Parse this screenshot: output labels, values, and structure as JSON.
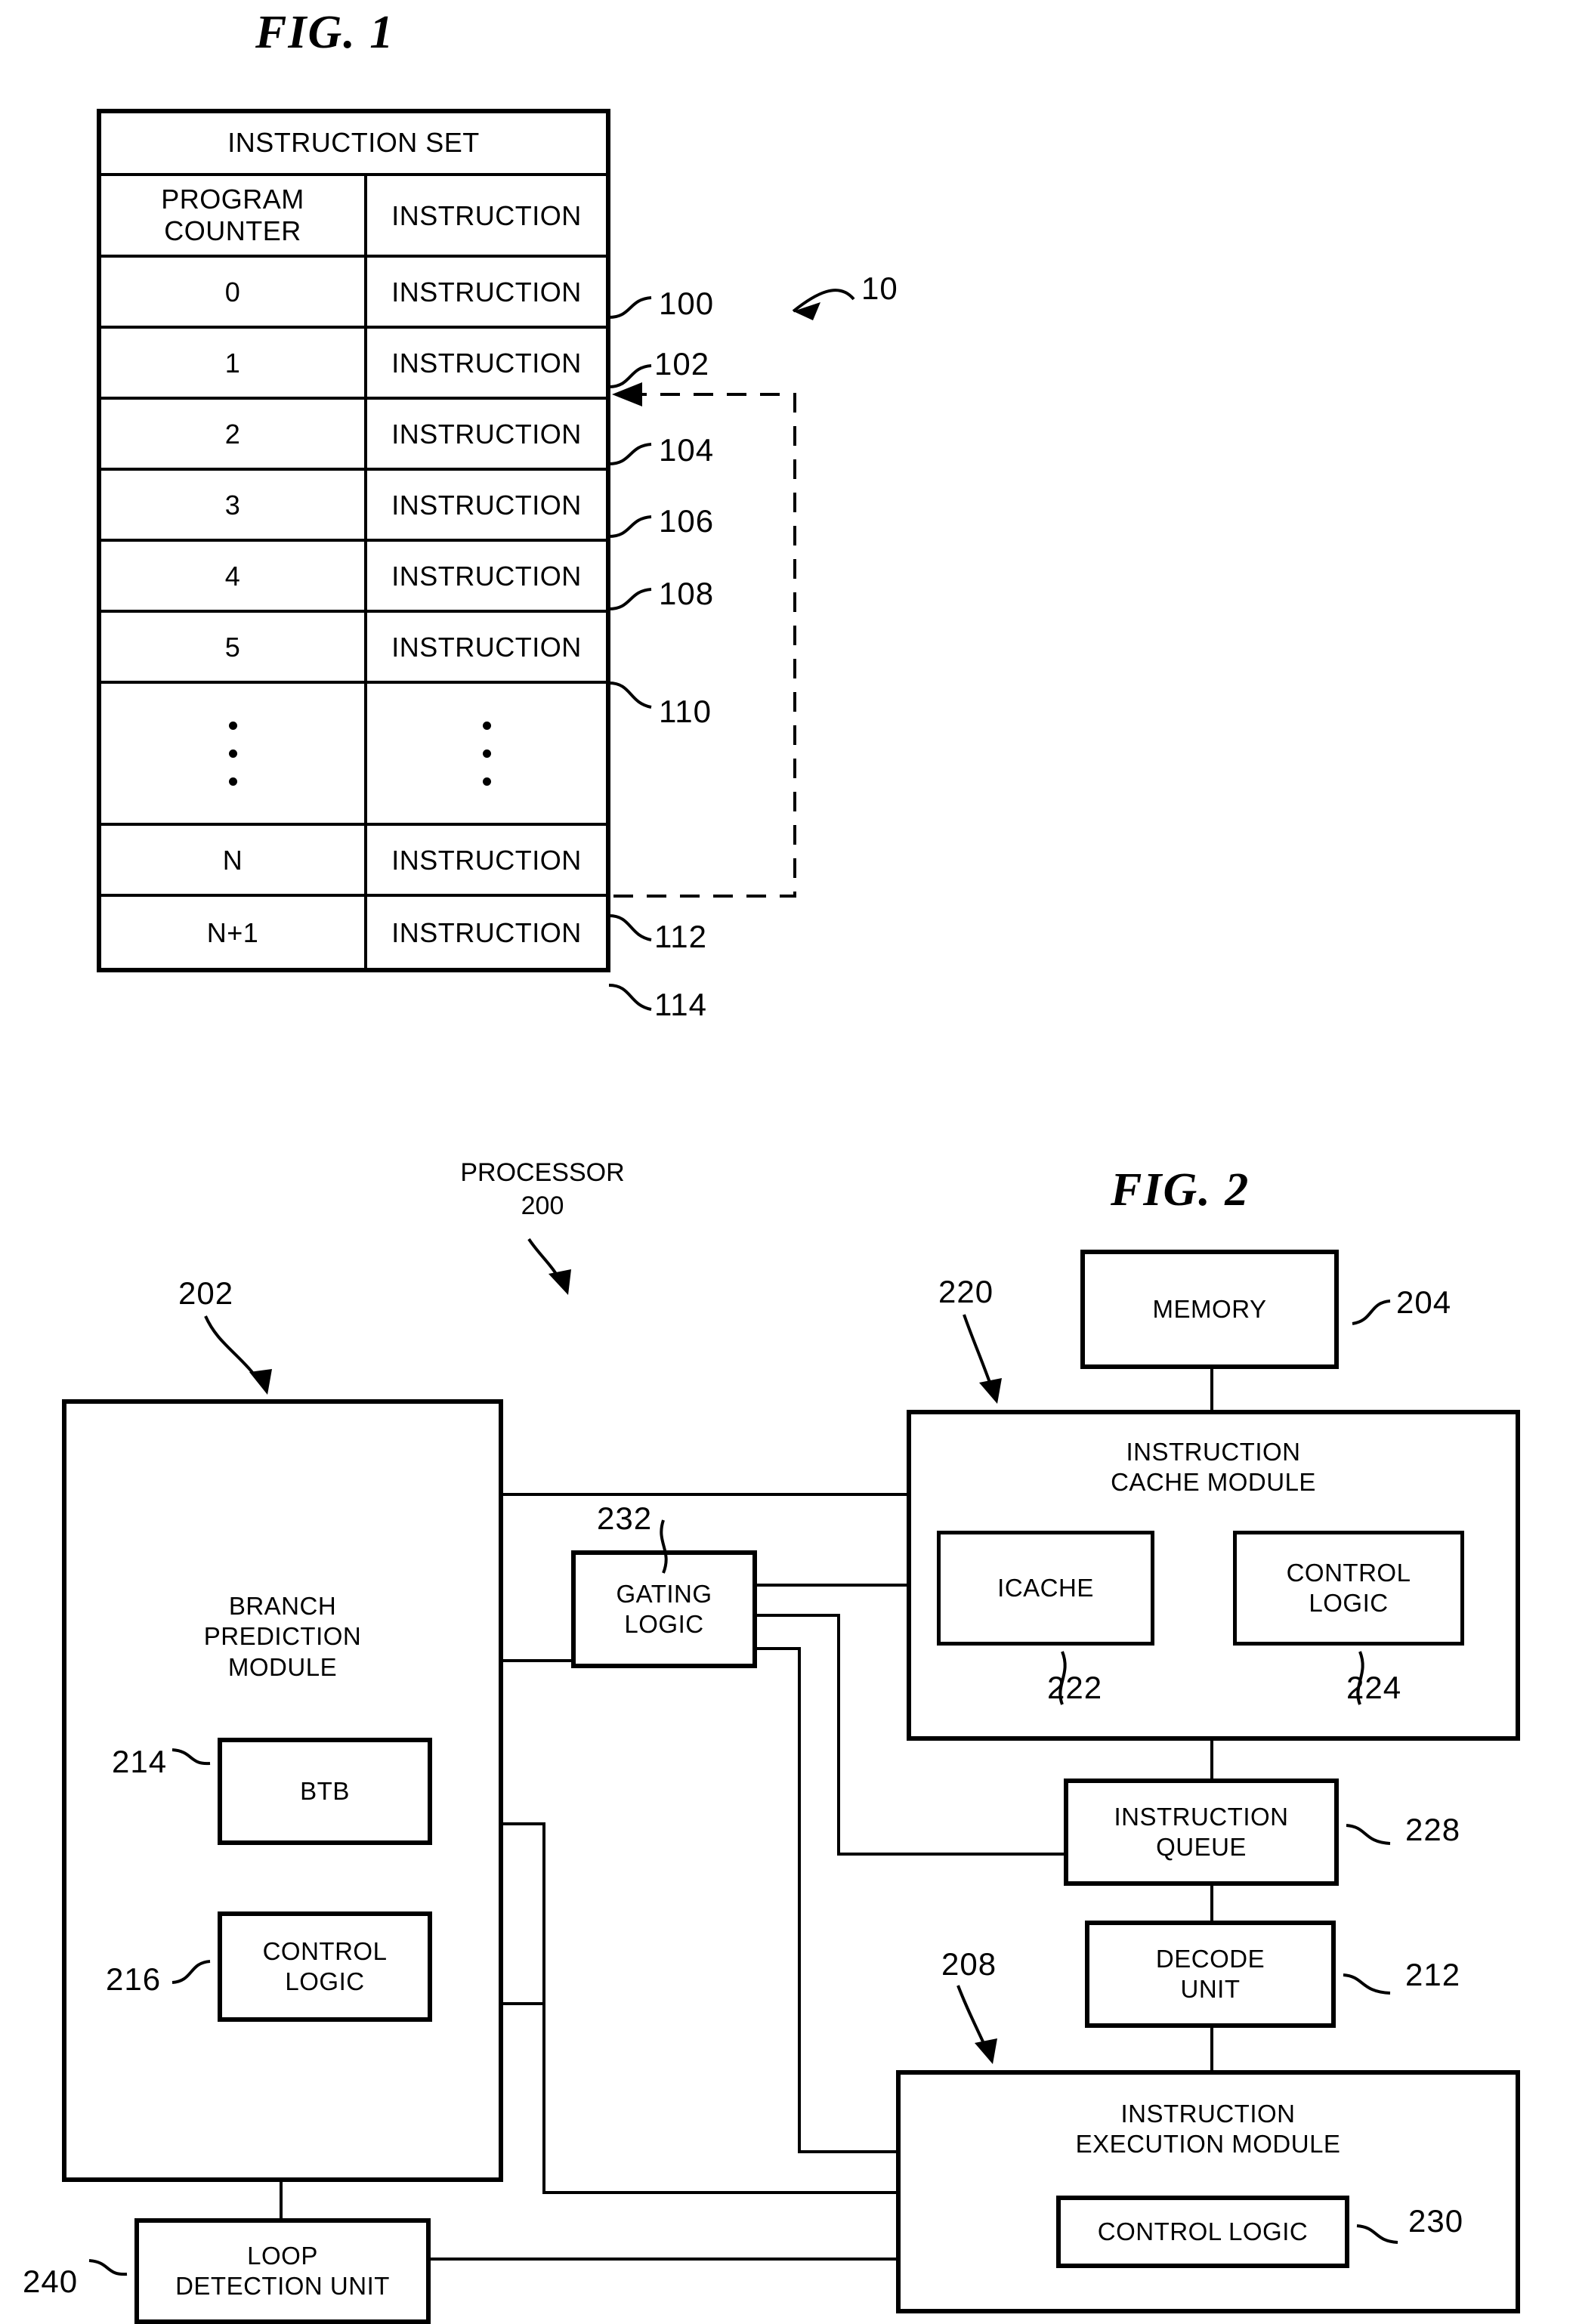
{
  "figures": {
    "fig1": {
      "title": "FIG. 1",
      "table": {
        "header": "INSTRUCTION SET",
        "columns": [
          "PROGRAM COUNTER",
          "INSTRUCTION"
        ],
        "col1_header_line1": "PROGRAM",
        "col1_header_line2": "COUNTER",
        "rows": [
          {
            "pc": "0",
            "instruction": "INSTRUCTION",
            "ref": "100"
          },
          {
            "pc": "1",
            "instruction": "INSTRUCTION",
            "ref": "102"
          },
          {
            "pc": "2",
            "instruction": "INSTRUCTION",
            "ref": "104"
          },
          {
            "pc": "3",
            "instruction": "INSTRUCTION",
            "ref": "106"
          },
          {
            "pc": "4",
            "instruction": "INSTRUCTION",
            "ref": "108"
          },
          {
            "pc": "5",
            "instruction": "INSTRUCTION",
            "ref": "110"
          },
          {
            "pc": "•••",
            "instruction": "•••",
            "ref": ""
          },
          {
            "pc": "N",
            "instruction": "INSTRUCTION",
            "ref": "112"
          },
          {
            "pc": "N+1",
            "instruction": "INSTRUCTION",
            "ref": "114"
          }
        ]
      },
      "system_ref": "10"
    },
    "fig2": {
      "title": "FIG. 2",
      "processor_label_line1": "PROCESSOR",
      "processor_label_line2": "200",
      "blocks": {
        "memory": {
          "label": "MEMORY",
          "ref": "204"
        },
        "branch_prediction_module": {
          "label": "BRANCH PREDICTION MODULE",
          "line1": "BRANCH",
          "line2": "PREDICTION",
          "line3": "MODULE",
          "ref": "202"
        },
        "instruction_cache_module": {
          "label": "INSTRUCTION CACHE MODULE",
          "line1": "INSTRUCTION",
          "line2": "CACHE MODULE",
          "ref": "220"
        },
        "icache": {
          "label": "ICACHE",
          "ref": "222"
        },
        "icache_control_logic": {
          "label": "CONTROL LOGIC",
          "line1": "CONTROL",
          "line2": "LOGIC",
          "ref": "224"
        },
        "gating_logic": {
          "label": "GATING LOGIC",
          "line1": "GATING",
          "line2": "LOGIC",
          "ref": "232"
        },
        "btb": {
          "label": "BTB",
          "ref": "214"
        },
        "bpm_control_logic": {
          "label": "CONTROL LOGIC",
          "line1": "CONTROL",
          "line2": "LOGIC",
          "ref": "216"
        },
        "instruction_queue": {
          "label": "INSTRUCTION QUEUE",
          "line1": "INSTRUCTION",
          "line2": "QUEUE",
          "ref": "228"
        },
        "decode_unit": {
          "label": "DECODE UNIT",
          "line1": "DECODE",
          "line2": "UNIT",
          "ref": "212"
        },
        "instruction_execution_module": {
          "label": "INSTRUCTION EXECUTION MODULE",
          "line1": "INSTRUCTION",
          "line2": "EXECUTION MODULE",
          "ref": "208"
        },
        "iem_control_logic": {
          "label": "CONTROL LOGIC",
          "ref": "230"
        },
        "loop_detection_unit": {
          "label": "LOOP DETECTION UNIT",
          "line1": "LOOP",
          "line2": "DETECTION UNIT",
          "ref": "240"
        }
      }
    }
  }
}
